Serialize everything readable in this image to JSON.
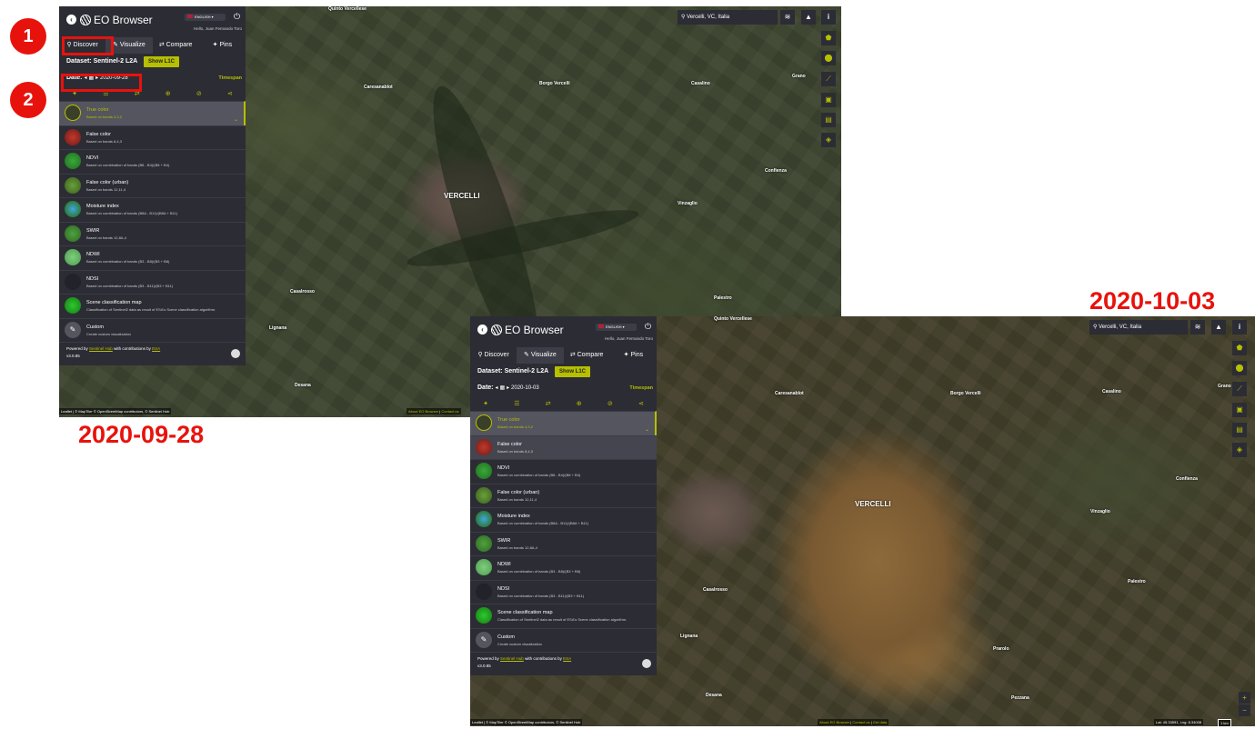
{
  "callouts": {
    "one": "1",
    "two": "2"
  },
  "date_labels": {
    "first": "2020-09-28",
    "second": "2020-10-03"
  },
  "app": {
    "logo": "EO Browser",
    "language": "ENGLISH",
    "greeting": "Hello, Juan Fernando Toro",
    "tabs": [
      "Discover",
      "Visualize",
      "Compare",
      "Pins"
    ],
    "dataset_label": "Dataset:",
    "dataset_value": "Sentinel-2 L2A",
    "show_l1c": "Show L1C",
    "date_label": "Date:",
    "timespan": "Timespan",
    "layers": [
      {
        "name": "True color",
        "desc": "Based on bands 4,3,2"
      },
      {
        "name": "False color",
        "desc": "Based on bands 8,4,3"
      },
      {
        "name": "NDVI",
        "desc": "Based on combination of bands (B8 - B4)/(B8 + B4)"
      },
      {
        "name": "False color (urban)",
        "desc": "Based on bands 12,11,4"
      },
      {
        "name": "Moisture index",
        "desc": "Based on combination of bands (B8A - B11)/(B8A + B11)"
      },
      {
        "name": "SWIR",
        "desc": "Based on bands 12,8A,4"
      },
      {
        "name": "NDWI",
        "desc": "Based on combination of bands (B3 - B8)/(B3 + B8)"
      },
      {
        "name": "NDSI",
        "desc": "Based on combination of bands (B3 - B11)/(B3 + B11)"
      },
      {
        "name": "Scene classification map",
        "desc": "Classification of Sentinel2 data as result of ESA's Scene classification algorithm."
      },
      {
        "name": "Custom",
        "desc": "Create custom visualization"
      }
    ],
    "footer_powered": "Powered by",
    "footer_hub": "Sentinel Hub",
    "footer_with": "with contributions by",
    "footer_esa": "ESA",
    "version": "v3.0.85",
    "search_value": "Vercelli, VC, Italia",
    "attribution": "Leaflet | © MapTiler © OpenStreetMap contributors, © Sentinel Hub",
    "about": "About EO Browser",
    "contact": "Contact us",
    "get_data": "Get data",
    "coords": "Lat: 45.33591, Lng: 8.34008",
    "scale": "1 km",
    "zoom_in": "+",
    "zoom_out": "−"
  },
  "screen1": {
    "date": "2020-09-28"
  },
  "screen2": {
    "date": "2020-10-03"
  },
  "places": {
    "city": "VERCELLI",
    "quinto": "Quinto Vercellese",
    "caresanablot": "Caresanablot",
    "borgo": "Borgo Vercelli",
    "casalino": "Casalino",
    "granozzo": "Grano",
    "confienza": "Confienza",
    "vinzaglio": "Vinzaglio",
    "palestro": "Palestro",
    "casalrosso": "Casalrosso",
    "lignana": "Lignana",
    "desana": "Desana",
    "prarolo": "Prarolo",
    "pezzana": "Pezzana"
  },
  "colors": {
    "accent": "#b6bf00",
    "panel": "#2c2c35",
    "callout": "#e8120c"
  }
}
